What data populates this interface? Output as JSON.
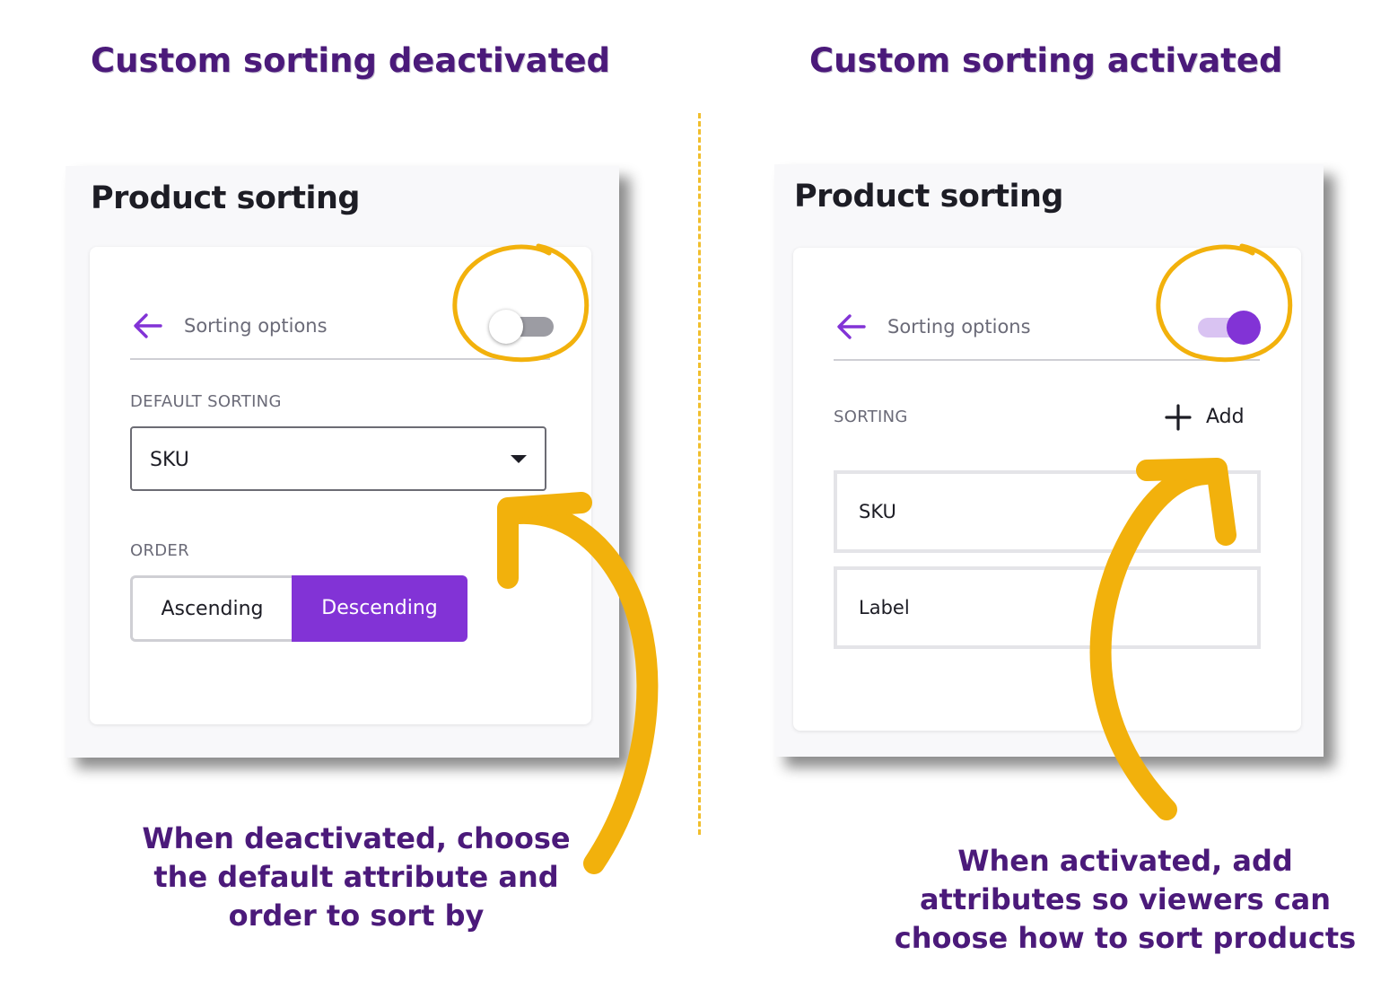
{
  "colors": {
    "heading": "#4b1a7a",
    "accent": "#8233d6",
    "highlight": "#f2b10c"
  },
  "left": {
    "heading": "Custom sorting deactivated",
    "panel_title": "Product sorting",
    "header_label": "Sorting options",
    "back_icon": "arrow-left-icon",
    "toggle_state": "off",
    "default_sorting_label": "DEFAULT SORTING",
    "default_sorting_value": "SKU",
    "order_label": "ORDER",
    "order_options": [
      "Ascending",
      "Descending"
    ],
    "order_selected": "Descending",
    "caption_lines": [
      "When deactivated, choose",
      "the default attribute and",
      "order to sort by"
    ]
  },
  "right": {
    "heading": "Custom sorting activated",
    "panel_title": "Product sorting",
    "header_label": "Sorting options",
    "back_icon": "arrow-left-icon",
    "toggle_state": "on",
    "sorting_label": "SORTING",
    "add_label": "Add",
    "add_icon": "plus-icon",
    "items": [
      "SKU",
      "Label"
    ],
    "caption_lines": [
      "When activated, add",
      "attributes so viewers can",
      "choose how to sort products"
    ]
  }
}
